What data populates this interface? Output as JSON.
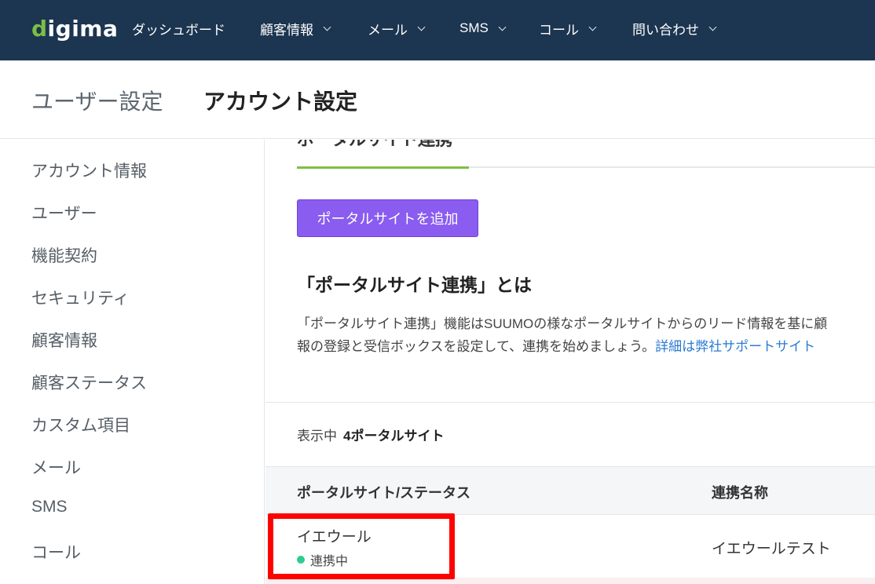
{
  "nav": {
    "logo_prefix": "d",
    "logo_rest": "igima",
    "items": [
      {
        "label": "ダッシュボード",
        "dropdown": false
      },
      {
        "label": "顧客情報",
        "dropdown": true
      },
      {
        "label": "メール",
        "dropdown": true
      },
      {
        "label": "SMS",
        "dropdown": true
      },
      {
        "label": "コール",
        "dropdown": true
      },
      {
        "label": "問い合わせ",
        "dropdown": true
      }
    ]
  },
  "header": {
    "user_settings": "ユーザー設定",
    "account_settings": "アカウント設定"
  },
  "sidebar": {
    "items": [
      "アカウント情報",
      "ユーザー",
      "機能契約",
      "セキュリティ",
      "顧客情報",
      "顧客ステータス",
      "カスタム項目",
      "メール",
      "SMS",
      "コール"
    ]
  },
  "main": {
    "section_title": "ポータルサイト連携",
    "add_button": "ポータルサイトを追加",
    "what_heading": "「ポータルサイト連携」とは",
    "description_line1": "「ポータルサイト連携」機能はSUUMOの様なポータルサイトからのリード情報を基に顧",
    "description_line2": "報の登録と受信ボックスを設定して、連携を始めましょう。",
    "description_link": "詳細は弊社サポートサイト",
    "count_label": "表示中",
    "count_value": "4ポータルサイト",
    "table": {
      "col_site_status": "ポータルサイト/ステータス",
      "col_alias": "連携名称",
      "rows": [
        {
          "site": "イエウール",
          "status": "連携中",
          "alias": "イエウールテスト"
        }
      ]
    }
  },
  "colors": {
    "nav_bg": "#1c3550",
    "accent_green": "#7bc043",
    "button_purple": "#8a5cf0",
    "status_green": "#2ecc8f",
    "link_blue": "#2a7bd1",
    "highlight_red": "#ff0000"
  }
}
